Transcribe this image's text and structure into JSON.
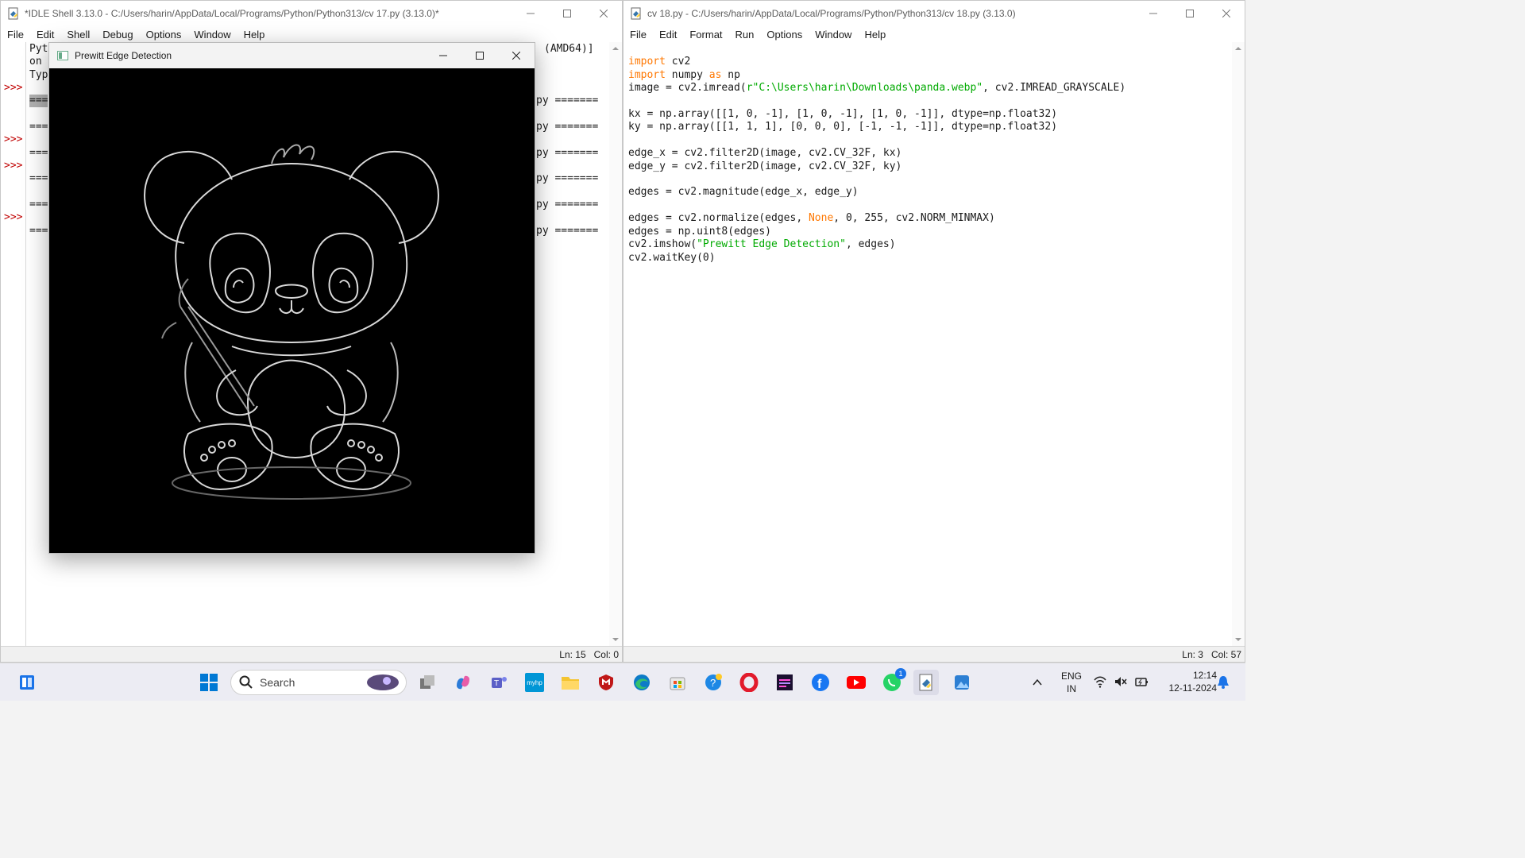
{
  "shell": {
    "title": "*IDLE Shell 3.13.0 - C:/Users/harin/AppData/Local/Programs/Python/Python313/cv 17.py (3.13.0)*",
    "menu": [
      "File",
      "Edit",
      "Shell",
      "Debug",
      "Options",
      "Window",
      "Help"
    ],
    "prompts": [
      ">>>",
      ">>>",
      ">>>",
      ">>>"
    ],
    "lines": [
      "Pyt",
      "on",
      "Typ"
    ],
    "amd": "(AMD64)]",
    "restart_lines": [
      "py =======",
      "py =======",
      "py =======",
      "py =======",
      "py =======",
      "py ======="
    ],
    "sep": "===",
    "status_ln": "Ln: 15",
    "status_col": "Col: 0"
  },
  "prewitt": {
    "title": "Prewitt Edge Detection"
  },
  "editor": {
    "title": "cv 18.py - C:/Users/harin/AppData/Local/Programs/Python/Python313/cv 18.py (3.13.0)",
    "menu": [
      "File",
      "Edit",
      "Format",
      "Run",
      "Options",
      "Window",
      "Help"
    ],
    "code": {
      "l1_kw": "import",
      "l1_rest": " cv2",
      "l2_kw": "import",
      "l2_mid": " numpy ",
      "l2_kw2": "as",
      "l2_rest": " np",
      "l3_a": "image = cv2.imread(",
      "l3_str": "r\"C:\\Users\\harin\\Downloads\\panda.webp\"",
      "l3_b": ", cv2.IMREAD_GRAYSCALE)",
      "l5": "kx = np.array([[1, 0, -1], [1, 0, -1], [1, 0, -1]], dtype=np.float32)",
      "l6": "ky = np.array([[1, 1, 1], [0, 0, 0], [-1, -1, -1]], dtype=np.float32)",
      "l8": "edge_x = cv2.filter2D(image, cv2.CV_32F, kx)",
      "l9": "edge_y = cv2.filter2D(image, cv2.CV_32F, ky)",
      "l11": "edges = cv2.magnitude(edge_x, edge_y)",
      "l13_a": "edges = cv2.normalize(edges, ",
      "l13_kw": "None",
      "l13_b": ", 0, 255, cv2.NORM_MINMAX)",
      "l14": "edges = np.uint8(edges)",
      "l15_a": "cv2.imshow(",
      "l15_str": "\"Prewitt Edge Detection\"",
      "l15_b": ", edges)",
      "l16": "cv2.waitKey(0)"
    },
    "status_ln": "Ln: 3",
    "status_col": "Col: 57"
  },
  "taskbar": {
    "search_placeholder": "Search",
    "lang1": "ENG",
    "lang2": "IN",
    "time": "12:14",
    "date": "12-11-2024",
    "whatsapp_badge": "1",
    "myhp_label": "myhp"
  }
}
